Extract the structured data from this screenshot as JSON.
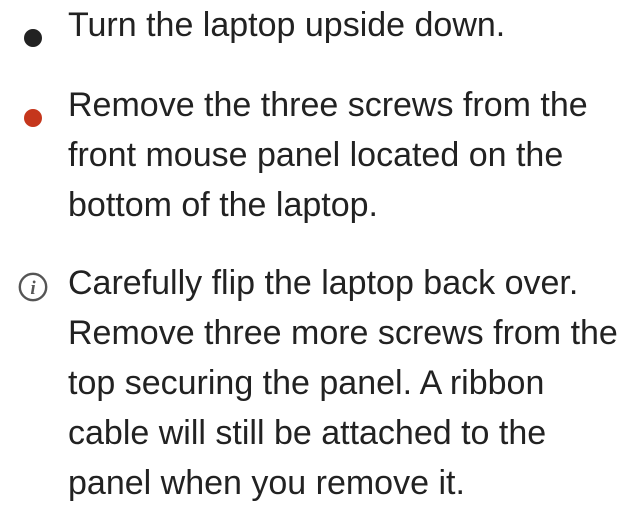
{
  "steps": [
    {
      "icon": "bullet-dark",
      "text": "Turn the laptop upside down."
    },
    {
      "icon": "bullet-red",
      "text": "Remove the three screws from the\nfront mouse panel located on the\nbottom of the laptop."
    },
    {
      "icon": "info-icon",
      "text": "Carefully flip the laptop back over.\nRemove three more screws from the\ntop securing the panel. A ribbon\ncable will still be attached to the\npanel when you remove it."
    }
  ],
  "colors": {
    "text": "#222222",
    "bullet_dark": "#222222",
    "bullet_red": "#c5361c",
    "info_icon": "#555555"
  }
}
